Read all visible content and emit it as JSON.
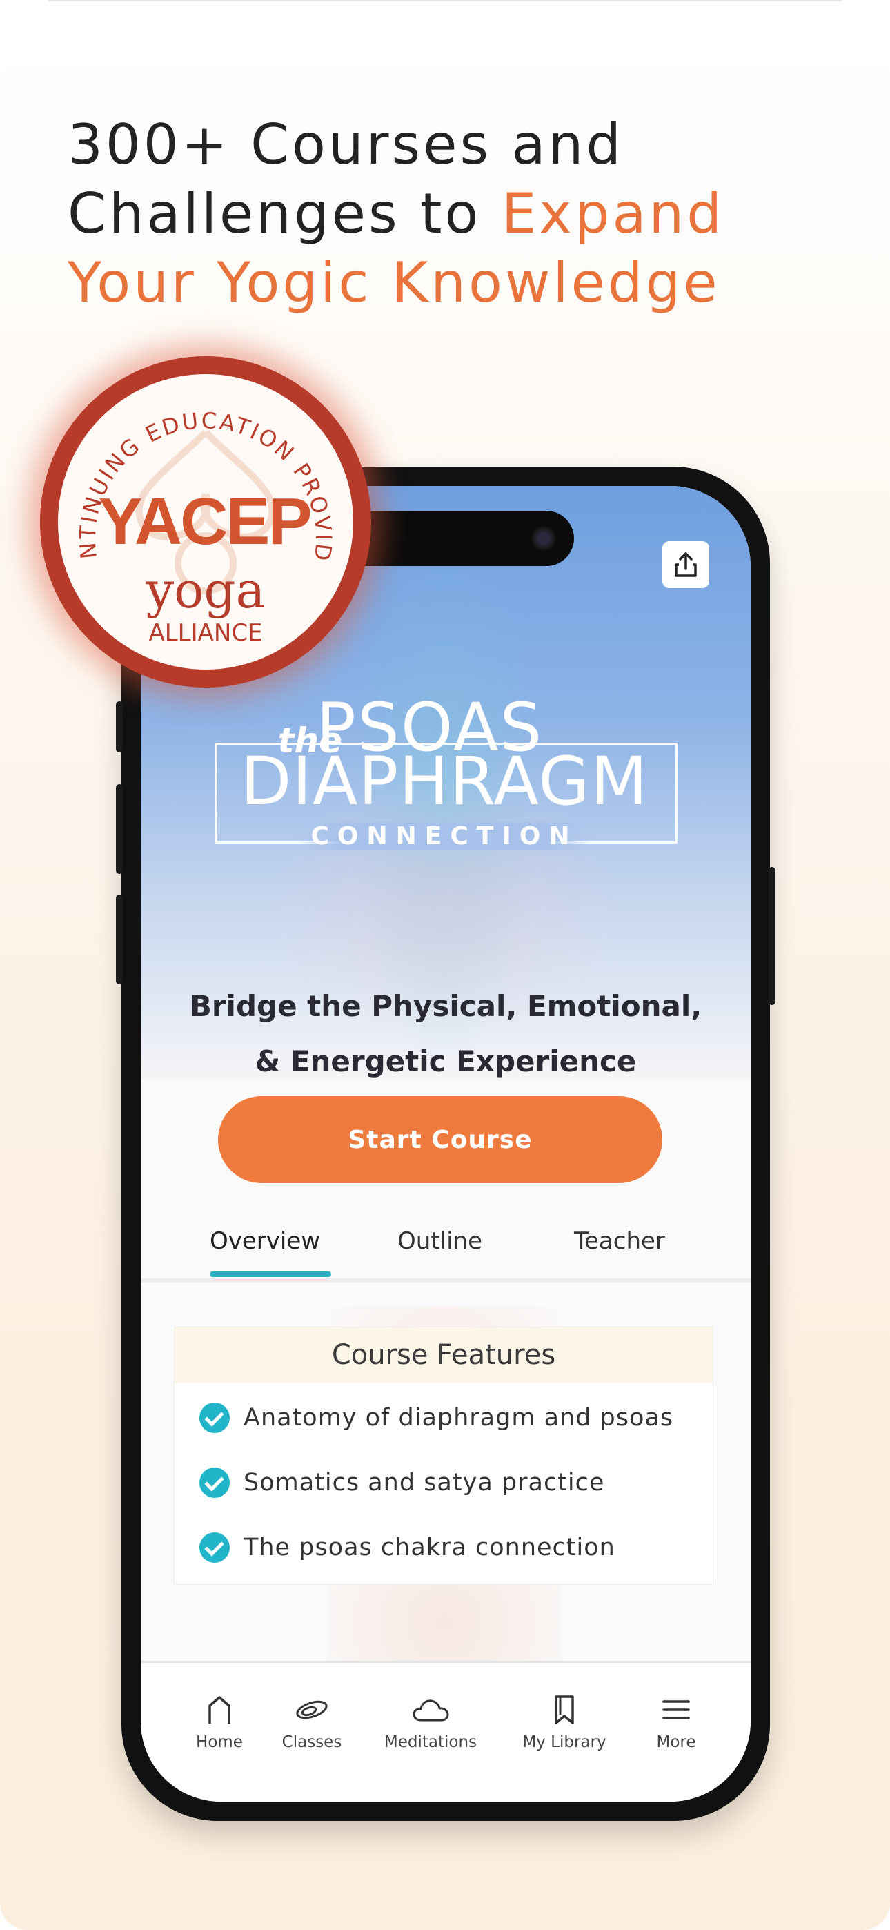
{
  "headline": {
    "line1": "300+ Courses and",
    "line2_plain": "Challenges to ",
    "line2_accent": "Expand",
    "line3_accent": "Your Yogic Knowledge"
  },
  "badge": {
    "arc_text": "CONTINUING EDUCATION PROVIDER",
    "main": "YACEP",
    "brand_script": "yoga",
    "brand_caps": "ALLIANCE"
  },
  "course": {
    "title_the": "the",
    "title_main": "PSOAS",
    "title_line2": "DIAPHRAGM",
    "title_line3": "CONNECTION",
    "subtitle_line1": "Bridge the Physical, Emotional,",
    "subtitle_line2": "& Energetic Experience",
    "start_button": "Start Course"
  },
  "tabs": [
    {
      "label": "Overview",
      "active": true
    },
    {
      "label": "Outline",
      "active": false
    },
    {
      "label": "Teacher",
      "active": false
    }
  ],
  "features": {
    "heading": "Course Features",
    "items": [
      "Anatomy of diaphragm and psoas",
      "Somatics and satya practice",
      "The psoas chakra connection"
    ]
  },
  "nav": [
    {
      "label": "Home",
      "icon": "home-icon"
    },
    {
      "label": "Classes",
      "icon": "classes-icon"
    },
    {
      "label": "Meditations",
      "icon": "cloud-icon"
    },
    {
      "label": "My Library",
      "icon": "bookmark-icon"
    },
    {
      "label": "More",
      "icon": "menu-icon"
    }
  ],
  "colors": {
    "accent_orange": "#e8743c",
    "button_orange": "#ee7a3e",
    "tab_teal": "#2aaec3",
    "check_teal": "#22b5c9",
    "badge_red": "#b73b2b"
  }
}
